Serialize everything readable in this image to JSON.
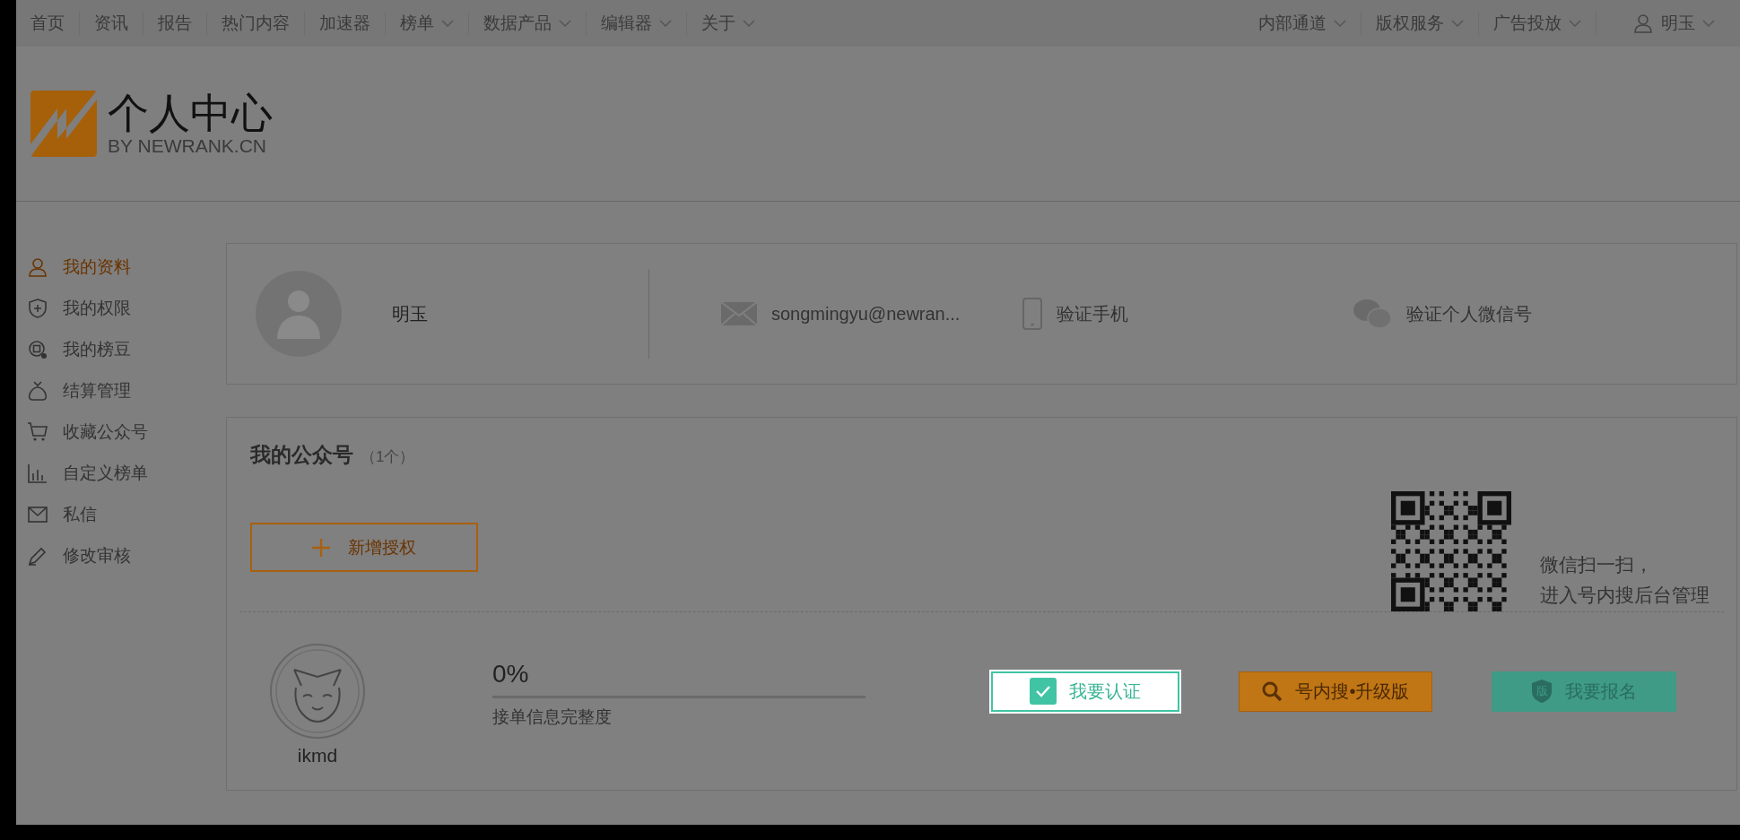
{
  "top_nav": {
    "left": [
      {
        "label": "首页",
        "has_menu": false
      },
      {
        "label": "资讯",
        "has_menu": false
      },
      {
        "label": "报告",
        "has_menu": false
      },
      {
        "label": "热门内容",
        "has_menu": false
      },
      {
        "label": "加速器",
        "has_menu": false
      },
      {
        "label": "榜单",
        "has_menu": true
      },
      {
        "label": "数据产品",
        "has_menu": true
      },
      {
        "label": "编辑器",
        "has_menu": true
      },
      {
        "label": "关于",
        "has_menu": true
      }
    ],
    "right": [
      {
        "label": "内部通道",
        "has_menu": true
      },
      {
        "label": "版权服务",
        "has_menu": true
      },
      {
        "label": "广告投放",
        "has_menu": true
      }
    ],
    "user": {
      "name": "明玉",
      "has_menu": true
    }
  },
  "header": {
    "title": "个人中心",
    "subtitle": "BY NEWRANK.CN"
  },
  "sidebar": {
    "items": [
      {
        "label": "我的资料",
        "selected": true
      },
      {
        "label": "我的权限",
        "selected": false
      },
      {
        "label": "我的榜豆",
        "selected": false
      },
      {
        "label": "结算管理",
        "selected": false
      },
      {
        "label": "收藏公众号",
        "selected": false
      },
      {
        "label": "自定义榜单",
        "selected": false
      },
      {
        "label": "私信",
        "selected": false
      },
      {
        "label": "修改审核",
        "selected": false
      }
    ]
  },
  "profile": {
    "name": "明玉",
    "contacts": [
      {
        "kind": "mail",
        "text": "songmingyu@newran..."
      },
      {
        "kind": "phone",
        "text": "验证手机"
      },
      {
        "kind": "wechat",
        "text": "验证个人微信号"
      }
    ]
  },
  "accounts": {
    "title": "我的公众号",
    "count": "（1个）",
    "add_button": "新增授权",
    "qr_caption": [
      "微信扫一扫，",
      "进入号内搜后台管理"
    ],
    "items": [
      {
        "name": "ikmd",
        "completeness": {
          "reading": "0%",
          "level": 0,
          "label": "接单信息完整度"
        },
        "actions": [
          {
            "kind": "verify",
            "label": "我要认证",
            "highlighted": true
          },
          {
            "kind": "search",
            "label": "号内搜•升级版",
            "highlighted": false
          },
          {
            "kind": "signup",
            "label": "我要报名",
            "badge": "版",
            "highlighted": false
          }
        ]
      }
    ]
  }
}
